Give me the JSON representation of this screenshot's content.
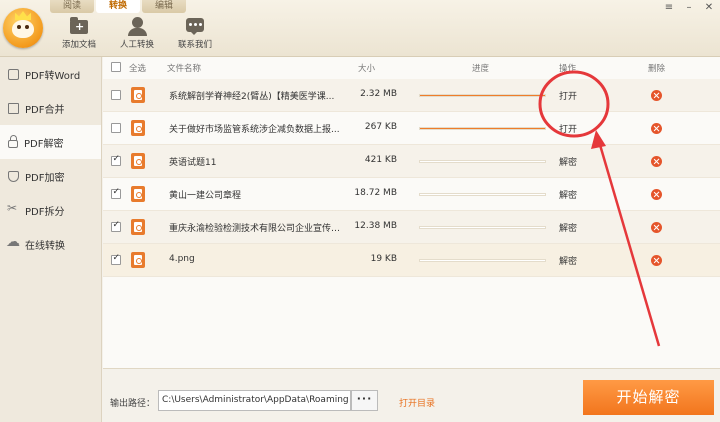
{
  "topbar": {
    "tabs": [
      {
        "label": "阅读"
      },
      {
        "label": "转换"
      },
      {
        "label": "编辑"
      }
    ],
    "tools": {
      "add_doc": "添加文档",
      "manual": "人工转换",
      "contact": "联系我们"
    },
    "window_buttons": {
      "menu": "≡",
      "minimize": "–",
      "close": "✕"
    }
  },
  "sidebar": {
    "items": [
      {
        "label": "PDF转Word"
      },
      {
        "label": "PDF合并"
      },
      {
        "label": "PDF解密"
      },
      {
        "label": "PDF加密"
      },
      {
        "label": "PDF拆分"
      },
      {
        "label": "在线转换"
      }
    ]
  },
  "table": {
    "headers": {
      "select_all": "全选",
      "filename": "文件名称",
      "size": "大小",
      "progress": "进度",
      "action": "操作",
      "delete": "删除"
    },
    "rows": [
      {
        "name": "系统解剖学脊神经2(臂丛)【精美医学课...",
        "size": "2.32 MB",
        "progress": 1.0,
        "action": "打开",
        "checked": false
      },
      {
        "name": "关于做好市场监管系统涉企减负数据上报...",
        "size": "267 KB",
        "progress": 1.0,
        "action": "打开",
        "checked": false
      },
      {
        "name": "英语试题11",
        "size": "421 KB",
        "progress": 0.0,
        "action": "解密",
        "checked": true
      },
      {
        "name": "黄山一建公司章程",
        "size": "18.72 MB",
        "progress": 0.0,
        "action": "解密",
        "checked": true
      },
      {
        "name": "重庆永渝检验检测技术有限公司企业宣传P...",
        "size": "12.38 MB",
        "progress": 0.0,
        "action": "解密",
        "checked": true
      },
      {
        "name": "4.png",
        "size": "19 KB",
        "progress": 0.0,
        "action": "解密",
        "checked": true
      }
    ]
  },
  "bottom": {
    "output_label": "输出路径：",
    "output_path": "C:\\Users\\Administrator\\AppData\\Roaming",
    "browse": "···",
    "open_dir": "打开目录",
    "start": "开始解密"
  },
  "colors": {
    "accent": "#ef7d2a",
    "annotation": "#e5383b",
    "delete": "#e5552b"
  }
}
